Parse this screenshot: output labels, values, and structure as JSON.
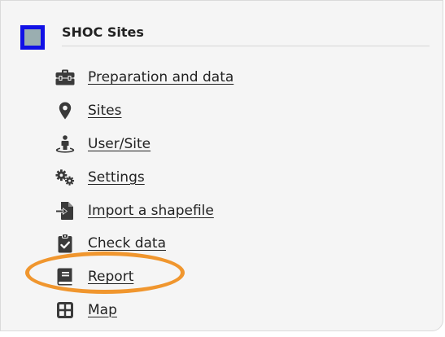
{
  "header": {
    "title": "SHOC Sites",
    "icon": "map-layer-square-icon",
    "icon_fill": "#9aaeb0",
    "icon_border": "#1111e6"
  },
  "menu": {
    "items": [
      {
        "label": "Preparation and data",
        "icon": "toolbox-icon"
      },
      {
        "label": "Sites",
        "icon": "map-marker-icon"
      },
      {
        "label": "User/Site",
        "icon": "street-view-icon"
      },
      {
        "label": "Settings",
        "icon": "cogs-icon"
      },
      {
        "label": "Import a shapefile",
        "icon": "file-import-icon"
      },
      {
        "label": "Check data",
        "icon": "clipboard-check-icon"
      },
      {
        "label": "Report",
        "icon": "book-icon"
      },
      {
        "label": "Map",
        "icon": "grid-icon"
      }
    ]
  },
  "annotation": {
    "highlighted_item": "Report",
    "color": "#f0962e"
  }
}
